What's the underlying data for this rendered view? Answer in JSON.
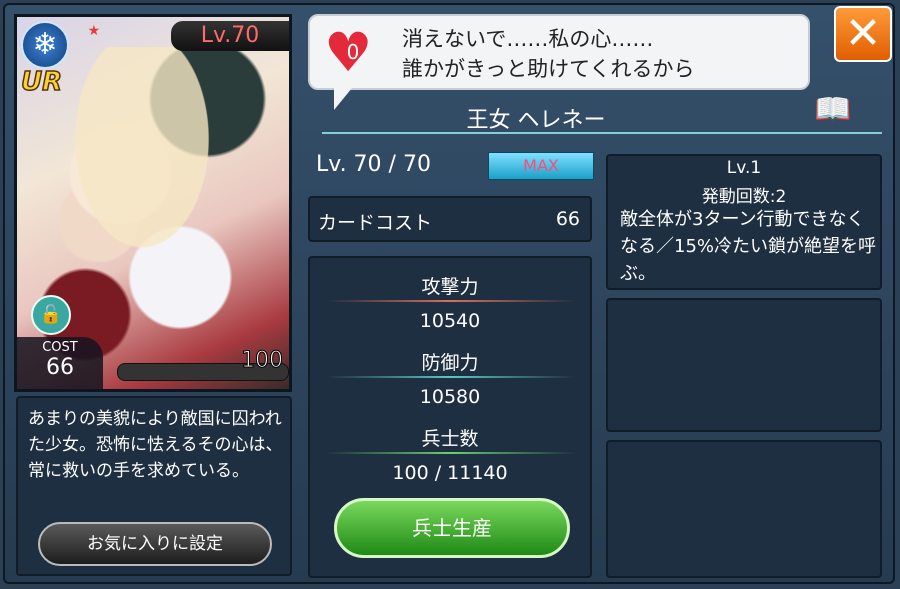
{
  "card": {
    "element_icon": "snowflake-icon",
    "stars": [
      "☆",
      "★"
    ],
    "rarity": "UR",
    "level_badge": "Lv.70",
    "cost_label": "COST",
    "cost_value": "66",
    "troops": "100",
    "troop_bar_fill": 1.0
  },
  "speech": {
    "heart_count": "0",
    "line1": "消えないで……私の心……",
    "line2": "誰かがきっと助けてくれるから"
  },
  "unit": {
    "name": "王女 ヘレネー",
    "level_text": "Lv. 70 / 70",
    "max_badge": "MAX"
  },
  "cost_row": {
    "label": "カードコスト",
    "value": "66"
  },
  "stats": {
    "attack_label": "攻撃力",
    "attack_value": "10540",
    "defense_label": "防御力",
    "defense_value": "10580",
    "soldiers_label": "兵士数",
    "soldiers_value": "100 / 11140",
    "produce_button": "兵士生産"
  },
  "skill": {
    "level": "Lv.1",
    "activations": "発動回数:2",
    "description": "敵全体が3ターン行動できなくなる／15%冷たい鎖が絶望を呼ぶ。"
  },
  "description": {
    "text": "あまりの美貌により敵国に囚われた少女。恐怖に怯えるその心は、常に救いの手を求めている。",
    "favorite_button": "お気に入りに設定"
  },
  "colors": {
    "accent_red": "#e22a3a",
    "close_orange": "#f07a10",
    "produce_green": "#3aa82a",
    "max_cyan": "#3cc4ea"
  }
}
